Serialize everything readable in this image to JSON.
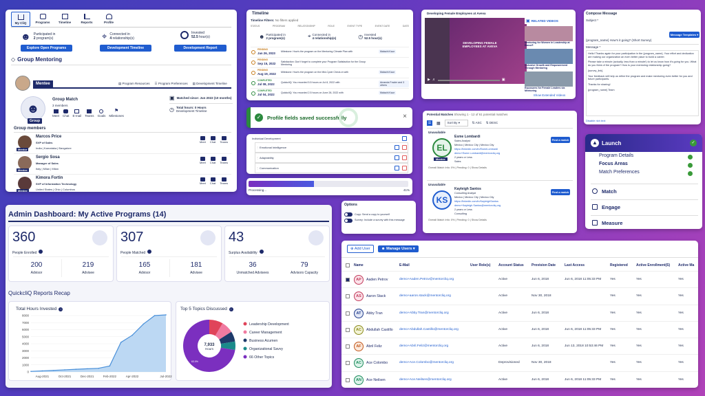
{
  "mycliq": {
    "tabs": [
      {
        "label": "My CliQ",
        "icon": "home-icon"
      },
      {
        "label": "Programs",
        "icon": "programs-icon"
      },
      {
        "label": "Timeline",
        "icon": "timeline-icon"
      },
      {
        "label": "Reports",
        "icon": "reports-icon"
      },
      {
        "label": "Profile",
        "icon": "profile-icon"
      }
    ],
    "stats": [
      {
        "line1": "Participated in",
        "line2_bold": "2",
        "line2_rest": " program(s)",
        "button": "Explore Open Programs"
      },
      {
        "line1": "Connected in",
        "line2_bold": "4",
        "line2_rest": " relationship(s)",
        "button": "Development Timeline"
      },
      {
        "line1": "Invested",
        "line2_bold": "52.5",
        "line2_rest": " hour(s)",
        "button": "Development Report"
      }
    ],
    "section_title": "Group Mentoring",
    "role_tab": "Mentee",
    "links": [
      "Program Resources",
      "Program Preferences",
      "Development Timeline"
    ],
    "group_name": "Group Match",
    "group_members_count": "3 members",
    "group_label": "Group",
    "group_actions": [
      "Meet",
      "Chat",
      "E-mail",
      "Teams",
      "Goals",
      "Milestones"
    ],
    "matched_since": "Matched since: Jun 2022 (10 months)",
    "total_hours": "Total hours: 0 Hours",
    "total_hours_sub": "Development Timeline",
    "members_title": "Group members",
    "members": [
      {
        "name": "Marcos Price",
        "title": "SVP of Sales",
        "location": "India | Karnataka | Bangalore",
        "badge": "Mentor"
      },
      {
        "name": "Sergio Sosa",
        "title": "Manager of Sales",
        "location": "Italy | Milan | Milan",
        "badge": "Mentee"
      },
      {
        "name": "Kimora Fortin",
        "title": "SVP of Information Technology",
        "location": "United States | Ohio | Columbus",
        "badge": "Mentee"
      }
    ],
    "member_actions": [
      "Meet",
      "Chat",
      "Teams"
    ]
  },
  "timeline": {
    "title": "Timeline",
    "filters_label": "Timeline Filters:",
    "filters_value": "No filters applied",
    "columns": [
      "STATUS",
      "PROGRAM",
      "RELATIONSHIP",
      "ROLE",
      "EVENT TYPE",
      "EVENT DATE",
      "DATE"
    ],
    "stats": [
      {
        "l1": "Participated in",
        "l2": "2 program(s)"
      },
      {
        "l1": "Connected in",
        "l2": "4 relationship(s)"
      },
      {
        "l1": "Invested",
        "l2": "52.5 hour(s)"
      }
    ],
    "events": [
      {
        "status": "PENDING",
        "date": "Jan 26, 2023",
        "text": "Milestone: How's the program on the Mentoring Climate Plan with",
        "who": "Malachi Kaur"
      },
      {
        "status": "PENDING",
        "date": "Sep 15, 2022",
        "text": "Satisfaction: Don't forget to complete your Program Satisfaction for the Group Mentoring",
        "who": ""
      },
      {
        "status": "PENDING",
        "date": "Aug 19, 2022",
        "text": "Milestone: How's the program on the Mid-Cycle Check-in with",
        "who": "Malachi Kaur"
      },
      {
        "status": "COMPLETED",
        "date": "Jul 08, 2022",
        "text": "QuickcliQ: You recorded 5.5 hours on Jul 8, 2022 with",
        "who": "Amanda Fowler and 3 others"
      },
      {
        "status": "COMPLETED",
        "date": "Jul 04, 2022",
        "text": "QuickcliQ: You recorded 2.5 hours on June 28, 2022 with",
        "who": "Malachi Kaur"
      }
    ]
  },
  "video": {
    "title": "Developing Female Employees at Aveva",
    "slide_text": "DEVELOPING FEMALE EMPLOYEES AT AVEVA",
    "related_title": "RELATED VIDEOS",
    "related": [
      "Mentoring for Women in Leadership at Barco®",
      "Inclusive Growth and Empowerment Through Mentoring",
      "Exposures for Female Leaders via Mentoring"
    ],
    "more": "Show Extended Videos"
  },
  "compose": {
    "title": "Compose Message",
    "subject_label": "Subject *",
    "subject_value": "{program_name} How's it going? (Short Survey)",
    "template_btn": "Message Templates",
    "message_label": "Message *",
    "body": [
      "Hello! Thanks again for your participation in the {program_name}. Your effort and dedication are making our organization an even better place to build a career.",
      "Please take a minute (actually, less than a minute!) to let us know how it's going for you. What do you think of the program? How is your mentoring relationship going?",
      "{survey_link}",
      "Your feedback will help us refine the program and make mentoring even better for you and future participants.",
      "Thanks for sharing!",
      "{program_name} Team"
    ],
    "footer": "Disable rich text"
  },
  "toast": {
    "text": "Profile fields saved successfully",
    "close": "×"
  },
  "devlist": {
    "items": [
      "Individual Development",
      "Emotional Intelligence",
      "Adaptability",
      "Communication"
    ]
  },
  "progress": {
    "label": "Processing...",
    "value": "41%",
    "fraction": 0.41
  },
  "matches": {
    "title": "Potential Matches",
    "summary": "Showing 1 - 12 of 61 potential matches",
    "sort_label": "Sort By",
    "asc": "ASC",
    "desc": "DESC",
    "people": [
      {
        "status": "Unavailable",
        "initials": "EL",
        "name": "Esme Lombardi",
        "title": "Sales Analyst",
        "location": "Mexico | Mexico City | Mexico City",
        "linkedin": "https://linkedin.com/in/EsmeLombardi",
        "email": "demo+Esme.Lombardi@mentorcliq.org",
        "years": "2 years or Less",
        "department": "Sales",
        "ring": "#2b8a3e",
        "bg": "#e6f4ea",
        "badge": "Mentee",
        "btn": "Find a match",
        "score": "Overall Match Info: 0% | Pending: 0 | Show Details"
      },
      {
        "status": "Unavailable",
        "initials": "KS",
        "name": "Kayleigh Santos",
        "title": "Consulting Analyst",
        "location": "Mexico | Mexico City | Mexico City",
        "linkedin": "https://linkedin.com/in/KayleighSantos",
        "email": "demo+Kayleigh.Santos@mentorcliq.org",
        "years": "2 years or Less",
        "department": "Consulting",
        "ring": "#1f5ccf",
        "bg": "#e7effc",
        "badge": "",
        "btn": "Find a match",
        "score": "Overall Match Info: 0% | Pending: 0 | Show Details"
      }
    ]
  },
  "launch": {
    "title": "Launch",
    "subitems": [
      "Program Details",
      "Focus Areas",
      "Match Preferences"
    ],
    "items": [
      "Match",
      "Engage",
      "Measure"
    ]
  },
  "options": {
    "title": "Options",
    "toggles": [
      "Copy: Send a copy to yourself",
      "Survey: Include a survey with this message"
    ]
  },
  "admin": {
    "title": "Admin Dashboard: My Active Programs (14)",
    "cards": [
      {
        "big": "360",
        "label": "People Enrolled",
        "sub": [
          {
            "v": "200",
            "l": "Advisor"
          },
          {
            "v": "219",
            "l": "Advisee"
          }
        ]
      },
      {
        "big": "307",
        "label": "People Matched",
        "sub": [
          {
            "v": "165",
            "l": "Advisor"
          },
          {
            "v": "181",
            "l": "Advisee"
          }
        ]
      },
      {
        "big": "43",
        "label": "Surplus Availability",
        "sub": [
          {
            "v": "36",
            "l": "Unmatched Advisees"
          },
          {
            "v": "79",
            "l": "Advisors Capacity"
          }
        ]
      }
    ],
    "recap_title": "QuickcliQ Reports Recap",
    "hours_title": "Total Hours Invested",
    "topics_title": "Top 5 Topics Discussed"
  },
  "chart_data": [
    {
      "type": "area",
      "title": "Total Hours Invested",
      "x": [
        "Jul-2021",
        "Aug-2021",
        "Sep-2021",
        "Oct-2021",
        "Nov-2021",
        "Dec-2021",
        "Jan-2022",
        "Feb-2022",
        "Mar-2022",
        "Apr-2022",
        "May-2022",
        "Jun-2022",
        "Jul-2022"
      ],
      "xticks": [
        "Aug-2021",
        "Oct-2021",
        "Dec-2021",
        "Feb-2022",
        "Apr-2022",
        "Jul-2022"
      ],
      "values": [
        80,
        150,
        220,
        300,
        380,
        450,
        520,
        850,
        4200,
        5200,
        6800,
        8000,
        8100
      ],
      "ylim": [
        0,
        8000
      ],
      "yticks": [
        0,
        1000,
        2000,
        3000,
        4000,
        5000,
        6000,
        7000,
        8000
      ],
      "grid": true,
      "color": "#4a90d9"
    },
    {
      "type": "pie",
      "title": "Top 5 Topics Discussed",
      "center_value": "7,933",
      "center_label": "Hours",
      "slices": [
        {
          "label": "Leadership Development",
          "value": 7.4,
          "color": "#e0445a"
        },
        {
          "label": "Career Management",
          "value": 6.5,
          "color": "#f07aa0"
        },
        {
          "label": "Business Acumen",
          "value": 5.5,
          "color": "#1e3a6a"
        },
        {
          "label": "Organizational Savvy",
          "value": 4.6,
          "color": "#1a8a8a"
        },
        {
          "label": "66 Other Topics",
          "value": 63.0,
          "color": "#7b2fbf"
        }
      ],
      "annotation": "63.0%",
      "legend": "right"
    }
  ],
  "users": {
    "add_btn": "Add User",
    "manage_btn": "Manage Users",
    "columns": [
      "Name",
      "E-Mail",
      "User Role(s)",
      "Account Status",
      "Provision Date",
      "Last Access",
      "Registered",
      "Active Enrollment(S)",
      "Active Ma"
    ],
    "rows": [
      {
        "initials": "AP",
        "name": "Aaden Petrov",
        "email": "demo+Aaden.Petrov@mentorcliq.org",
        "status": "Active",
        "prov": "Jun 6, 2018",
        "last": "Jun 6, 2018 11:05:33 PM",
        "reg": "Yes",
        "enr": "Yes",
        "act": "Yes",
        "checked": true,
        "color": "#c23a5a",
        "bg": "#fbe3ea"
      },
      {
        "initials": "AS",
        "name": "Aaron Stack",
        "email": "demo+aaron.stack@mentorcliq.org",
        "status": "Active",
        "prov": "Nov 30, 2018",
        "last": "",
        "reg": "Yes",
        "enr": "Yes",
        "act": "Yes",
        "checked": false,
        "color": "#c23a5a",
        "bg": "#fbe3ea"
      },
      {
        "initials": "AT",
        "name": "Abby Tran",
        "email": "demo+Abby.Tran@mentorcliq.org",
        "status": "Active",
        "prov": "Jun 6, 2018",
        "last": "",
        "reg": "Yes",
        "enr": "Yes",
        "act": "Yes",
        "checked": false,
        "color": "#1e3a8a",
        "bg": "#e3e8f6"
      },
      {
        "initials": "AC",
        "name": "Abdullah Castillo",
        "email": "demo+Abdullah.Castillo@mentorcliq.org",
        "status": "Active",
        "prov": "Jun 6, 2018",
        "last": "Jun 6, 2018 11:05:33 PM",
        "reg": "Yes",
        "enr": "Yes",
        "act": "Yes",
        "checked": false,
        "color": "#8a8a1a",
        "bg": "#f3f3d6"
      },
      {
        "initials": "AF",
        "name": "Abril Feliz",
        "email": "demo+Abril.Feliz@mentorcliq.org",
        "status": "Active",
        "prov": "Jun 6, 2018",
        "last": "Jun 13, 2018 10:53:46 PM",
        "reg": "Yes",
        "enr": "Yes",
        "act": "Yes",
        "checked": false,
        "color": "#c2561a",
        "bg": "#fbe9dc"
      },
      {
        "initials": "AC",
        "name": "Ace Colombo",
        "email": "demo+Ace.Colombo@mentorcliq.org",
        "status": "Deprovisioned",
        "prov": "Nov 30, 2018",
        "last": "",
        "reg": "Yes",
        "enr": "Yes",
        "act": "Yes",
        "checked": false,
        "color": "#1a8a5a",
        "bg": "#dcf3ea"
      },
      {
        "initials": "AN",
        "name": "Ace Neilsen",
        "email": "demo+Ace.Neilsen@mentorcliq.org",
        "status": "Active",
        "prov": "Jun 6, 2018",
        "last": "Jun 6, 2018 11:05:33 PM",
        "reg": "Yes",
        "enr": "Yes",
        "act": "Yes",
        "checked": false,
        "color": "#1a8a5a",
        "bg": "#dcf3ea"
      }
    ]
  }
}
